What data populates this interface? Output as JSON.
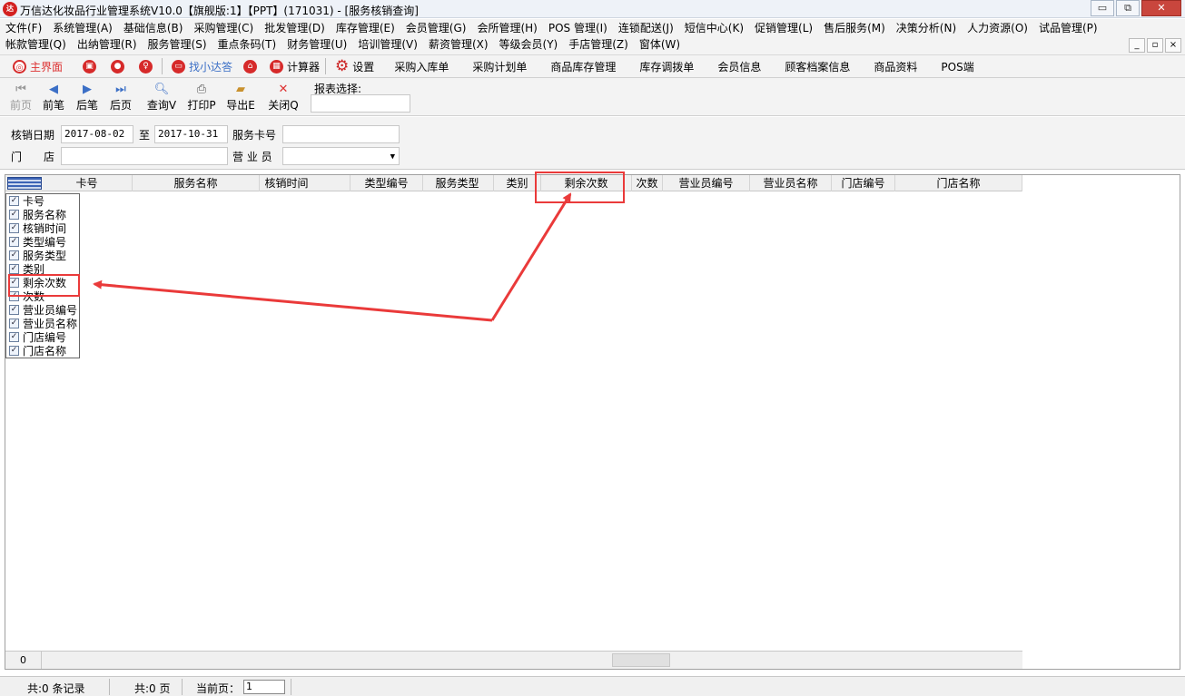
{
  "window": {
    "title": "万信达化妆品行业管理系统V10.0【旗舰版:1】【PPT】(171031) - [服务核销查询]",
    "icon": "app-logo-icon",
    "min_label": "▭",
    "restore_label": "⧉",
    "close_label": "✕"
  },
  "menu": {
    "row1": [
      "文件(F)",
      "系统管理(A)",
      "基础信息(B)",
      "采购管理(C)",
      "批发管理(D)",
      "库存管理(E)",
      "会员管理(G)",
      "会所管理(H)",
      "POS 管理(I)",
      "连锁配送(J)",
      "短信中心(K)",
      "促销管理(L)",
      "售后服务(M)",
      "决策分析(N)",
      "人力资源(O)",
      "试品管理(P)"
    ],
    "row2": [
      "帐款管理(Q)",
      "出纳管理(R)",
      "服务管理(S)",
      "重点条码(T)",
      "财务管理(U)",
      "培训管理(V)",
      "薪资管理(X)",
      "等级会员(Y)",
      "手店管理(Z)",
      "窗体(W)"
    ],
    "mdi_min": "_",
    "mdi_restore": "▫",
    "mdi_close": "×"
  },
  "quickbar": {
    "home": "主界面",
    "find": "找小达答",
    "calculator": "计算器",
    "settings": "设置",
    "links": [
      "采购入库单",
      "采购计划单",
      "商品库存管理",
      "库存调拨单",
      "会员信息",
      "顾客档案信息",
      "商品资料",
      "POS端"
    ]
  },
  "toolbar": {
    "first": "前页",
    "prev": "前笔",
    "next": "后笔",
    "last": "后页",
    "query": "查询V",
    "print": "打印P",
    "export": "导出E",
    "close": "关闭Q",
    "report_label": "报表选择:"
  },
  "filters": {
    "date_label": "核销日期",
    "date_from": "2017-08-02",
    "to_label": "至",
    "date_to": "2017-10-31",
    "card_label": "服务卡号",
    "card_value": "",
    "store_label": "门　　店",
    "store_value": "",
    "clerk_label": "营 业 员",
    "clerk_value": ""
  },
  "grid": {
    "columns": [
      "卡号",
      "服务名称",
      "核销时间",
      "类型编号",
      "服务类型",
      "类别",
      "剩余次数",
      "次数",
      "营业员编号",
      "营业员名称",
      "门店编号",
      "门店名称"
    ],
    "column_chooser": [
      {
        "label": "卡号",
        "checked": true
      },
      {
        "label": "服务名称",
        "checked": true
      },
      {
        "label": "核销时间",
        "checked": true
      },
      {
        "label": "类型编号",
        "checked": true
      },
      {
        "label": "服务类型",
        "checked": true
      },
      {
        "label": "类别",
        "checked": true
      },
      {
        "label": "剩余次数",
        "checked": true
      },
      {
        "label": "次数",
        "checked": true
      },
      {
        "label": "营业员编号",
        "checked": true
      },
      {
        "label": "营业员名称",
        "checked": true
      },
      {
        "label": "门店编号",
        "checked": true
      },
      {
        "label": "门店名称",
        "checked": true
      }
    ],
    "footer_count": "0",
    "check_mark": "✓"
  },
  "status": {
    "records": "共:0 条记录",
    "pages": "共:0 页",
    "current_label": "当前页：",
    "current_page": "1"
  },
  "colors": {
    "annotation": "#ea3a3a",
    "accent_red": "#d62a2a"
  }
}
